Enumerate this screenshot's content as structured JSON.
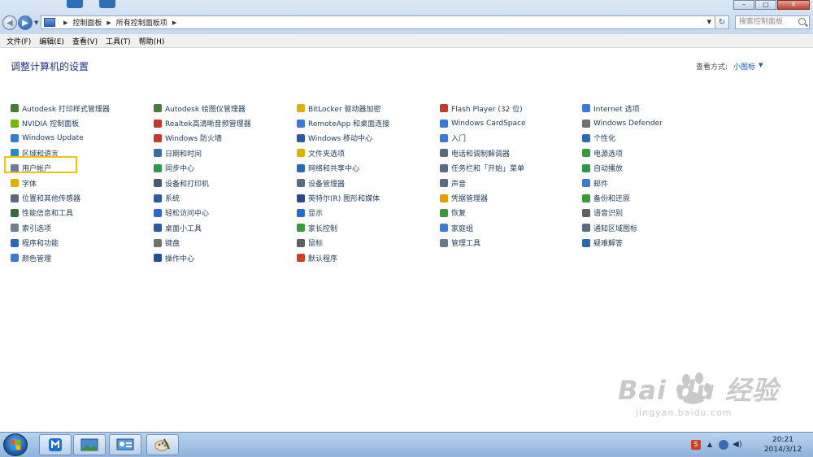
{
  "address_bar": {
    "crumbs": [
      "控制面板",
      "所有控制面板项"
    ],
    "search_placeholder": "搜索控制面板"
  },
  "menu": [
    "文件(F)",
    "编辑(E)",
    "查看(V)",
    "工具(T)",
    "帮助(H)"
  ],
  "page": {
    "title": "调整计算机的设置",
    "view_by_label": "查看方式:",
    "view_by_value": "小图标"
  },
  "columns": [
    [
      "Autodesk 打印样式管理器",
      "NVIDIA 控制面板",
      "Windows Update",
      "区域和语言",
      "用户帐户",
      "字体",
      "位置和其他传感器",
      "性能信息和工具",
      "索引选项",
      "程序和功能",
      "颜色管理"
    ],
    [
      "Autodesk 绘图仪管理器",
      "Realtek高清晰音频管理器",
      "Windows 防火墙",
      "日期和时间",
      "同步中心",
      "设备和打印机",
      "系统",
      "轻松访问中心",
      "桌面小工具",
      "键盘",
      "操作中心"
    ],
    [
      "BitLocker 驱动器加密",
      "RemoteApp 和桌面连接",
      "Windows 移动中心",
      "文件夹选项",
      "网络和共享中心",
      "设备管理器",
      "英特尔(R) 图形和媒体",
      "显示",
      "家长控制",
      "鼠标",
      "默认程序"
    ],
    [
      "Flash Player (32 位)",
      "Windows CardSpace",
      "入门",
      "电话和调制解调器",
      "任务栏和「开始」菜单",
      "声音",
      "凭据管理器",
      "恢复",
      "家庭组",
      "管理工具"
    ],
    [
      "Internet 选项",
      "Windows Defender",
      "个性化",
      "电源选项",
      "自动播放",
      "邮件",
      "备份和还原",
      "语音识别",
      "通知区域图标",
      "疑难解答"
    ]
  ],
  "icon_colors": [
    [
      "#4a7a3a",
      "#76b900",
      "#2e7fd0",
      "#2a8ac8",
      "#6a7fa0",
      "#e0b000",
      "#5a6a80",
      "#3a6a3a",
      "#708090",
      "#2a6ab0",
      "#3a7ad0"
    ],
    [
      "#4a7a3a",
      "#c0392b",
      "#c0392b",
      "#3a6aa8",
      "#2a9a4a",
      "#4a5a70",
      "#2a5aa0",
      "#2a6ad0",
      "#2a5aa0",
      "#707070",
      "#2a4a9a"
    ],
    [
      "#e0b000",
      "#3a7ad0",
      "#2a5aa0",
      "#e0b000",
      "#2a6ab0",
      "#5a6a80",
      "#2a4a8a",
      "#2a6ad0",
      "#3a9a3a",
      "#606060",
      "#d04020"
    ],
    [
      "#c0392b",
      "#3a7ad0",
      "#3a7ad0",
      "#5a6a80",
      "#5a6a80",
      "#5a6a80",
      "#e0a000",
      "#3a9a3a",
      "#3a7ad0",
      "#6a7a90"
    ],
    [
      "#3a7ad0",
      "#707070",
      "#2a6ab0",
      "#3a9a3a",
      "#2a9a4a",
      "#3a7ad0",
      "#3a9a3a",
      "#606060",
      "#5a6a80",
      "#2a6ab0"
    ]
  ],
  "watermark": {
    "logo": "Bai  du 经验",
    "url": "jingyan.baidu.com"
  },
  "clock": {
    "time": "20:21",
    "date": "2014/3/12"
  }
}
